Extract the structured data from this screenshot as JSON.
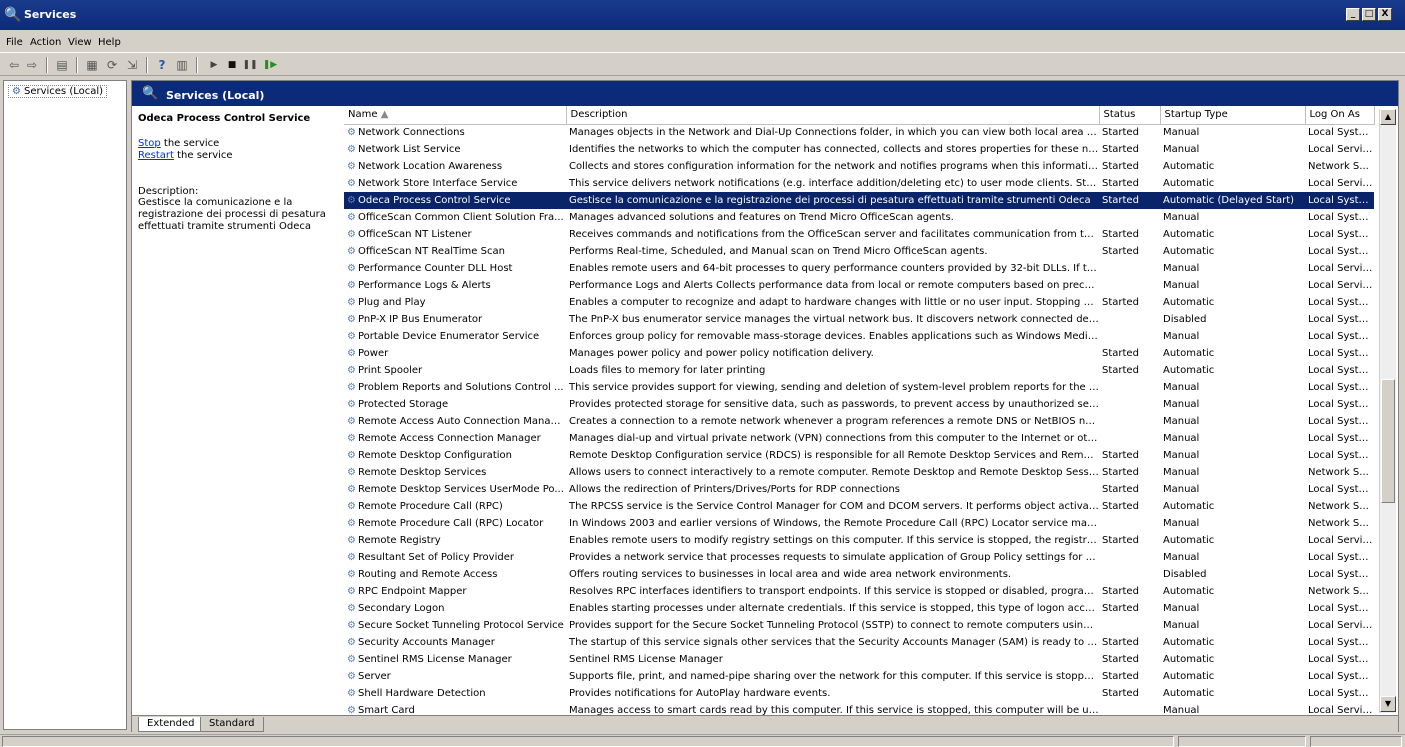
{
  "window": {
    "title": "Services",
    "buttons": [
      "_",
      "□",
      "X"
    ]
  },
  "menu": [
    "File",
    "Action",
    "View",
    "Help"
  ],
  "toolbar_icons": [
    "back-icon",
    "forward-icon",
    "show-hide-tree-icon",
    "properties-icon",
    "refresh-icon",
    "export-list-icon",
    "help-icon",
    "view-icon",
    "start-service-icon",
    "stop-service-icon",
    "pause-service-icon",
    "restart-service-icon"
  ],
  "tree": {
    "item": "Services (Local)"
  },
  "pane": {
    "header": "Services (Local)"
  },
  "details": {
    "service_name": "Odeca Process Control Service",
    "stop_link": "Stop",
    "stop_text": " the service",
    "restart_link": "Restart",
    "restart_text": " the service",
    "description_label": "Description:",
    "description": "Gestisce la comunicazione e la registrazione dei processi di pesatura effettuati tramite strumenti Odeca"
  },
  "columns": {
    "name": "Name",
    "description": "Description",
    "status": "Status",
    "startup": "Startup Type",
    "logon": "Log On As"
  },
  "services": [
    [
      "Network Connections",
      "Manages objects in the Network and Dial-Up Connections folder, in which you can view both local area net...",
      "Started",
      "Manual",
      "Local System"
    ],
    [
      "Network List Service",
      "Identifies the networks to which the computer has connected, collects and stores properties for these net...",
      "Started",
      "Manual",
      "Local Service"
    ],
    [
      "Network Location Awareness",
      "Collects and stores configuration information for the network and notifies programs when this information i...",
      "Started",
      "Automatic",
      "Network S..."
    ],
    [
      "Network Store Interface Service",
      "This service delivers network notifications (e.g. interface addition/deleting etc) to user mode clients. Stopp...",
      "Started",
      "Automatic",
      "Local Service"
    ],
    [
      "Odeca Process Control Service",
      "Gestisce la comunicazione e la registrazione dei processi di pesatura effettuati tramite strumenti Odeca",
      "Started",
      "Automatic (Delayed Start)",
      "Local System"
    ],
    [
      "OfficeScan Common Client Solution Fra...",
      "Manages advanced solutions and features on Trend Micro OfficeScan agents.",
      "",
      "Manual",
      "Local System"
    ],
    [
      "OfficeScan NT Listener",
      "Receives commands and notifications from the OfficeScan server and facilitates communication from the O...",
      "Started",
      "Automatic",
      "Local System"
    ],
    [
      "OfficeScan NT RealTime Scan",
      "Performs Real-time, Scheduled, and Manual scan on Trend Micro OfficeScan agents.",
      "Started",
      "Automatic",
      "Local System"
    ],
    [
      "Performance Counter DLL Host",
      "Enables remote users and 64-bit processes to query performance counters provided by 32-bit DLLs. If this...",
      "",
      "Manual",
      "Local Service"
    ],
    [
      "Performance Logs & Alerts",
      "Performance Logs and Alerts Collects performance data from local or remote computers based on preconfi...",
      "",
      "Manual",
      "Local Service"
    ],
    [
      "Plug and Play",
      "Enables a computer to recognize and adapt to hardware changes with little or no user input. Stopping or di...",
      "Started",
      "Automatic",
      "Local System"
    ],
    [
      "PnP-X IP Bus Enumerator",
      "The PnP-X bus enumerator service manages the virtual network bus. It discovers network connected devic...",
      "",
      "Disabled",
      "Local System"
    ],
    [
      "Portable Device Enumerator Service",
      "Enforces group policy for removable mass-storage devices. Enables applications such as Windows Media Pl...",
      "",
      "Manual",
      "Local System"
    ],
    [
      "Power",
      "Manages power policy and power policy notification delivery.",
      "Started",
      "Automatic",
      "Local System"
    ],
    [
      "Print Spooler",
      "Loads files to memory for later printing",
      "Started",
      "Automatic",
      "Local System"
    ],
    [
      "Problem Reports and Solutions Control ...",
      "This service provides support for viewing, sending and deletion of system-level problem reports for the Pro...",
      "",
      "Manual",
      "Local System"
    ],
    [
      "Protected Storage",
      "Provides protected storage for sensitive data, such as passwords, to prevent access by unauthorized ser...",
      "",
      "Manual",
      "Local System"
    ],
    [
      "Remote Access Auto Connection Manager",
      "Creates a connection to a remote network whenever a program references a remote DNS or NetBIOS nam...",
      "",
      "Manual",
      "Local System"
    ],
    [
      "Remote Access Connection Manager",
      "Manages dial-up and virtual private network (VPN) connections from this computer to the Internet or other...",
      "",
      "Manual",
      "Local System"
    ],
    [
      "Remote Desktop Configuration",
      "Remote Desktop Configuration service (RDCS) is responsible for all Remote Desktop Services and Remote ...",
      "Started",
      "Manual",
      "Local System"
    ],
    [
      "Remote Desktop Services",
      "Allows users to connect interactively to a remote computer. Remote Desktop and Remote Desktop Session...",
      "Started",
      "Manual",
      "Network S..."
    ],
    [
      "Remote Desktop Services UserMode Po...",
      "Allows the redirection of Printers/Drives/Ports for RDP connections",
      "Started",
      "Manual",
      "Local System"
    ],
    [
      "Remote Procedure Call (RPC)",
      "The RPCSS service is the Service Control Manager for COM and DCOM servers. It performs object activati...",
      "Started",
      "Automatic",
      "Network S..."
    ],
    [
      "Remote Procedure Call (RPC) Locator",
      "In Windows 2003 and earlier versions of Windows, the Remote Procedure Call (RPC) Locator service mana...",
      "",
      "Manual",
      "Network S..."
    ],
    [
      "Remote Registry",
      "Enables remote users to modify registry settings on this computer. If this service is stopped, the registry c...",
      "Started",
      "Automatic",
      "Local Service"
    ],
    [
      "Resultant Set of Policy Provider",
      "Provides a network service that processes requests to simulate application of Group Policy settings for a ta...",
      "",
      "Manual",
      "Local System"
    ],
    [
      "Routing and Remote Access",
      "Offers routing services to businesses in local area and wide area network environments.",
      "",
      "Disabled",
      "Local System"
    ],
    [
      "RPC Endpoint Mapper",
      "Resolves RPC interfaces identifiers to transport endpoints. If this service is stopped or disabled, programs ...",
      "Started",
      "Automatic",
      "Network S..."
    ],
    [
      "Secondary Logon",
      "Enables starting processes under alternate credentials. If this service is stopped, this type of logon access...",
      "Started",
      "Manual",
      "Local System"
    ],
    [
      "Secure Socket Tunneling Protocol Service",
      "Provides support for the Secure Socket Tunneling Protocol (SSTP) to connect to remote computers using V...",
      "",
      "Manual",
      "Local Service"
    ],
    [
      "Security Accounts Manager",
      "The startup of this service signals other services that the Security Accounts Manager (SAM) is ready to ac...",
      "Started",
      "Automatic",
      "Local System"
    ],
    [
      "Sentinel RMS License Manager",
      "Sentinel RMS License Manager",
      "Started",
      "Automatic",
      "Local System"
    ],
    [
      "Server",
      "Supports file, print, and named-pipe sharing over the network for this computer. If this service is stopped,...",
      "Started",
      "Automatic",
      "Local System"
    ],
    [
      "Shell Hardware Detection",
      "Provides notifications for AutoPlay hardware events.",
      "Started",
      "Automatic",
      "Local System"
    ],
    [
      "Smart Card",
      "Manages access to smart cards read by this computer. If this service is stopped, this computer will be una...",
      "",
      "Manual",
      "Local Service"
    ]
  ],
  "selected_row": 4,
  "tabs": [
    "Extended",
    "Standard"
  ],
  "colors": {
    "title_bar": "#0c2a7a",
    "selection": "#0a246a",
    "link": "#0033cc"
  }
}
